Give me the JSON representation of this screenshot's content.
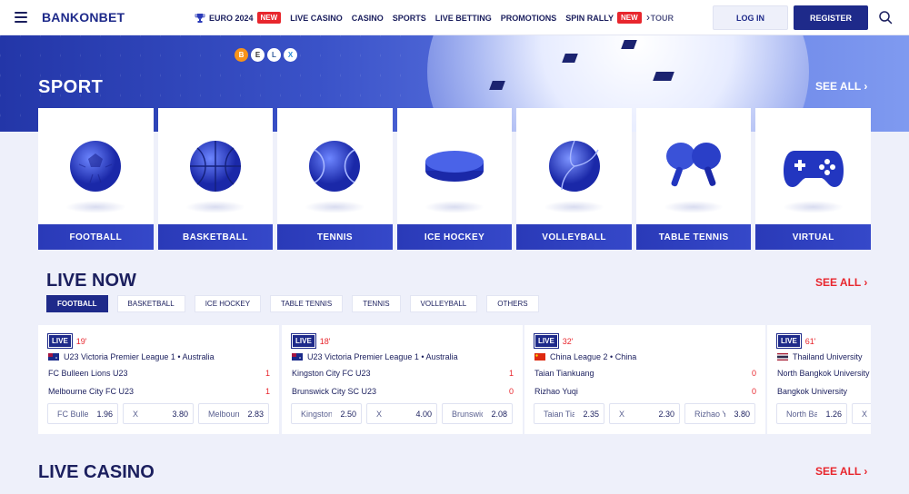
{
  "header": {
    "logo": "BANKONBET",
    "nav": [
      {
        "label": "EURO 2024",
        "badge": "NEW",
        "icon": "trophy-icon"
      },
      {
        "label": "LIVE CASINO"
      },
      {
        "label": "CASINO"
      },
      {
        "label": "SPORTS"
      },
      {
        "label": "LIVE BETTING"
      },
      {
        "label": "PROMOTIONS"
      },
      {
        "label": "SPIN RALLY",
        "badge": "NEW"
      },
      {
        "label": "TOUR"
      }
    ],
    "login": "LOG IN",
    "register": "REGISTER"
  },
  "hero": {
    "title": "SPORT",
    "see_all": "SEE ALL",
    "crypto": [
      "B",
      "E",
      "L",
      "X"
    ]
  },
  "sports": [
    {
      "label": "FOOTBALL",
      "icon": "football-icon"
    },
    {
      "label": "BASKETBALL",
      "icon": "basketball-icon"
    },
    {
      "label": "TENNIS",
      "icon": "tennis-ball-icon"
    },
    {
      "label": "ICE HOCKEY",
      "icon": "hockey-puck-icon"
    },
    {
      "label": "VOLLEYBALL",
      "icon": "volleyball-icon"
    },
    {
      "label": "TABLE TENNIS",
      "icon": "table-tennis-icon"
    },
    {
      "label": "VIRTUAL",
      "icon": "gamepad-icon"
    }
  ],
  "live": {
    "title": "LIVE NOW",
    "see_all": "SEE ALL",
    "tabs": [
      "FOOTBALL",
      "BASKETBALL",
      "ICE HOCKEY",
      "TABLE TENNIS",
      "TENNIS",
      "VOLLEYBALL",
      "OTHERS"
    ],
    "matches": [
      {
        "live": "LIVE",
        "minute": "19'",
        "flag": "australia",
        "league": "U23 Victoria Premier League 1 • Australia",
        "home": "FC Bulleen Lions U23",
        "home_score": "1",
        "away": "Melbourne City FC U23",
        "away_score": "1",
        "odds": [
          {
            "name": "FC Bulleen Lions",
            "value": "1.96"
          },
          {
            "name": "X",
            "value": "3.80"
          },
          {
            "name": "Melbourne City",
            "value": "2.83"
          }
        ]
      },
      {
        "live": "LIVE",
        "minute": "18'",
        "flag": "australia",
        "league": "U23 Victoria Premier League 1 • Australia",
        "home": "Kingston City FC U23",
        "home_score": "1",
        "away": "Brunswick City SC U23",
        "away_score": "0",
        "odds": [
          {
            "name": "Kingston City",
            "value": "2.50"
          },
          {
            "name": "X",
            "value": "4.00"
          },
          {
            "name": "Brunswick",
            "value": "2.08"
          }
        ]
      },
      {
        "live": "LIVE",
        "minute": "32'",
        "flag": "china",
        "league": "China League 2 • China",
        "home": "Taian Tiankuang",
        "home_score": "0",
        "away": "Rizhao Yuqi",
        "away_score": "0",
        "odds": [
          {
            "name": "Taian Tiankuang",
            "value": "2.35"
          },
          {
            "name": "X",
            "value": "2.30"
          },
          {
            "name": "Rizhao Yuqi",
            "value": "3.80"
          }
        ]
      },
      {
        "live": "LIVE",
        "minute": "61'",
        "flag": "thailand",
        "league": "Thailand University",
        "home": "North Bangkok University",
        "home_score": "",
        "away": "Bangkok University",
        "away_score": "",
        "odds": [
          {
            "name": "North Bangkok",
            "value": "1.26"
          },
          {
            "name": "X",
            "value": ""
          }
        ]
      }
    ]
  },
  "casino": {
    "title": "LIVE CASINO",
    "see_all": "SEE ALL"
  },
  "colors": {
    "brand": "#1e2a8a",
    "accent_red": "#e8262d",
    "page_bg": "#eef0fa"
  }
}
